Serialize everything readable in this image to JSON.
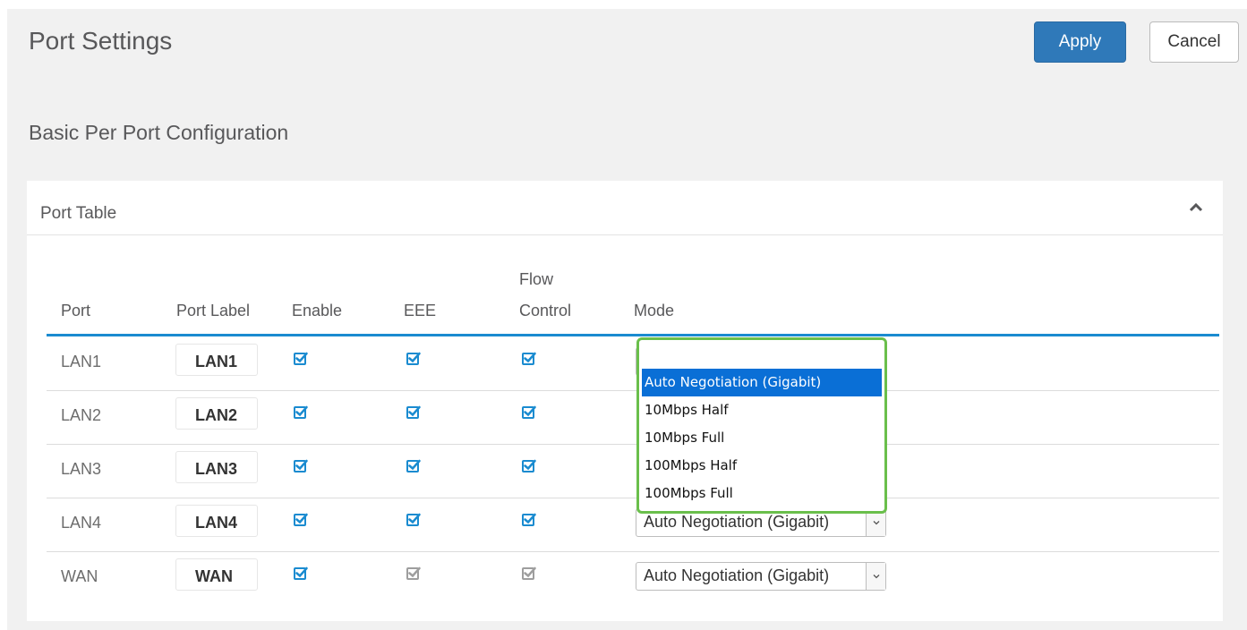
{
  "header": {
    "title": "Port Settings",
    "apply_label": "Apply",
    "cancel_label": "Cancel"
  },
  "section": {
    "title": "Basic Per Port Configuration"
  },
  "panel": {
    "title": "Port Table"
  },
  "columns": {
    "port": "Port",
    "port_label": "Port Label",
    "enable": "Enable",
    "eee": "EEE",
    "flow_line1": "Flow",
    "flow_line2": "Control",
    "mode": "Mode"
  },
  "rows": [
    {
      "port": "LAN1",
      "label": "LAN1",
      "enable": true,
      "eee": true,
      "flow": true,
      "mode": "Auto Negotiation (Gigabit)"
    },
    {
      "port": "LAN2",
      "label": "LAN2",
      "enable": true,
      "eee": true,
      "flow": true,
      "mode": ""
    },
    {
      "port": "LAN3",
      "label": "LAN3",
      "enable": true,
      "eee": true,
      "flow": true,
      "mode": ""
    },
    {
      "port": "LAN4",
      "label": "LAN4",
      "enable": true,
      "eee": true,
      "flow": true,
      "mode": "Auto Negotiation (Gigabit)"
    },
    {
      "port": "WAN",
      "label": "WAN",
      "enable": true,
      "eee": false,
      "flow": false,
      "mode": "Auto Negotiation (Gigabit)"
    }
  ],
  "dropdown": {
    "options": [
      "Auto Negotiation (Gigabit)",
      "10Mbps Half",
      "10Mbps Full",
      "100Mbps Half",
      "100Mbps Full"
    ],
    "selected": "Auto Negotiation (Gigabit)"
  },
  "colors": {
    "accent": "#1a8bd0",
    "apply": "#2f79b9",
    "highlight": "#6abf4b",
    "checkbox": "#1a8bd0",
    "checkbox_disabled": "#9e9e9e"
  },
  "icons": {
    "panel_toggle": "chevron-up-icon",
    "checkbox": "checkbox-checked-icon",
    "select_arrow": "chevron-down-icon"
  }
}
